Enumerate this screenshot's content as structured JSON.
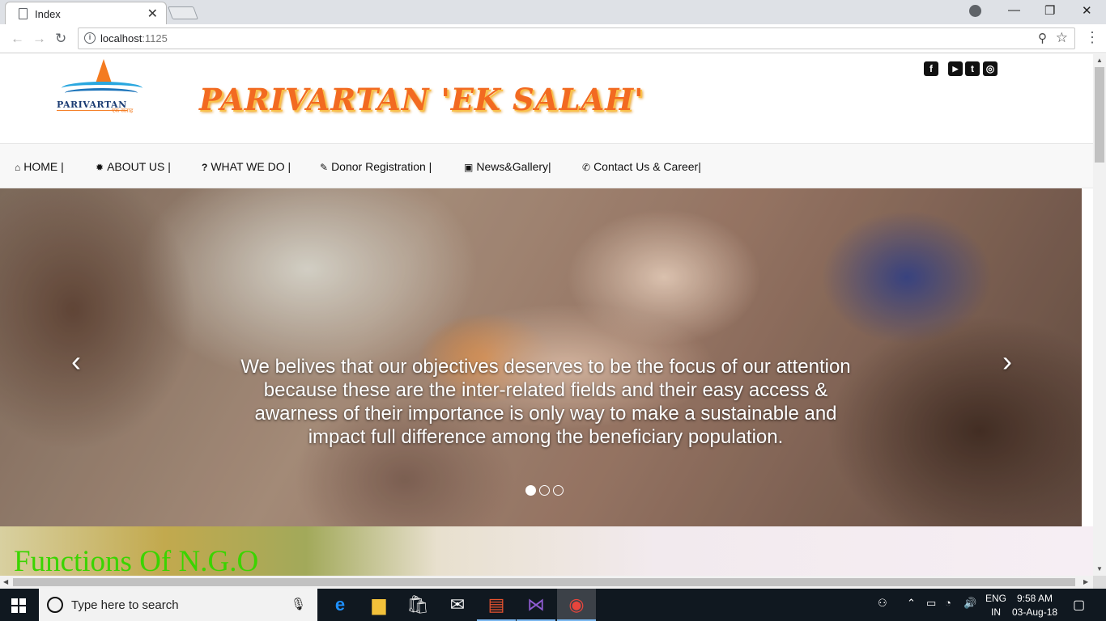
{
  "browser": {
    "tab_title": "Index",
    "url_host": "localhost",
    "url_port": ":1125"
  },
  "site": {
    "logo_text": "PARIVARTAN",
    "logo_subtext": "एक सलाह",
    "brand_title": "PARIVARTAN 'EK SALAH'",
    "social": [
      {
        "icon": "facebook-icon",
        "glyph": "f"
      },
      {
        "icon": "youtube-icon",
        "glyph": "▶"
      },
      {
        "icon": "twitter-icon",
        "glyph": "t"
      },
      {
        "icon": "instagram-icon",
        "glyph": "◎"
      }
    ],
    "nav": [
      {
        "label": "HOME |",
        "icon": "home-icon",
        "glyph": "⌂"
      },
      {
        "label": "ABOUT US |",
        "icon": "certificate-icon",
        "glyph": "✹"
      },
      {
        "label": "WHAT WE DO |",
        "icon": "question-icon",
        "glyph": "?"
      },
      {
        "label": "Donor Registration |",
        "icon": "edit-icon",
        "glyph": "✎"
      },
      {
        "label": "News&Gallery|",
        "icon": "picture-icon",
        "glyph": "▣"
      },
      {
        "label": "Contact Us & Career|",
        "icon": "phone-icon",
        "glyph": "✆"
      }
    ],
    "carousel": {
      "caption": "We belives that our objectives deserves to be the focus of our attention because these are the inter-related fields and their easy access & awarness of their importance is only way to make a sustainable and impact full difference among the beneficiary population.",
      "prev": "‹",
      "next": "›",
      "slides": 3,
      "active_slide": 1
    },
    "section_heading": "Functions Of N.G.O"
  },
  "taskbar": {
    "search_placeholder": "Type here to search",
    "lang_line1": "ENG",
    "lang_line2": "IN",
    "time": "9:58 AM",
    "date": "03-Aug-18"
  }
}
